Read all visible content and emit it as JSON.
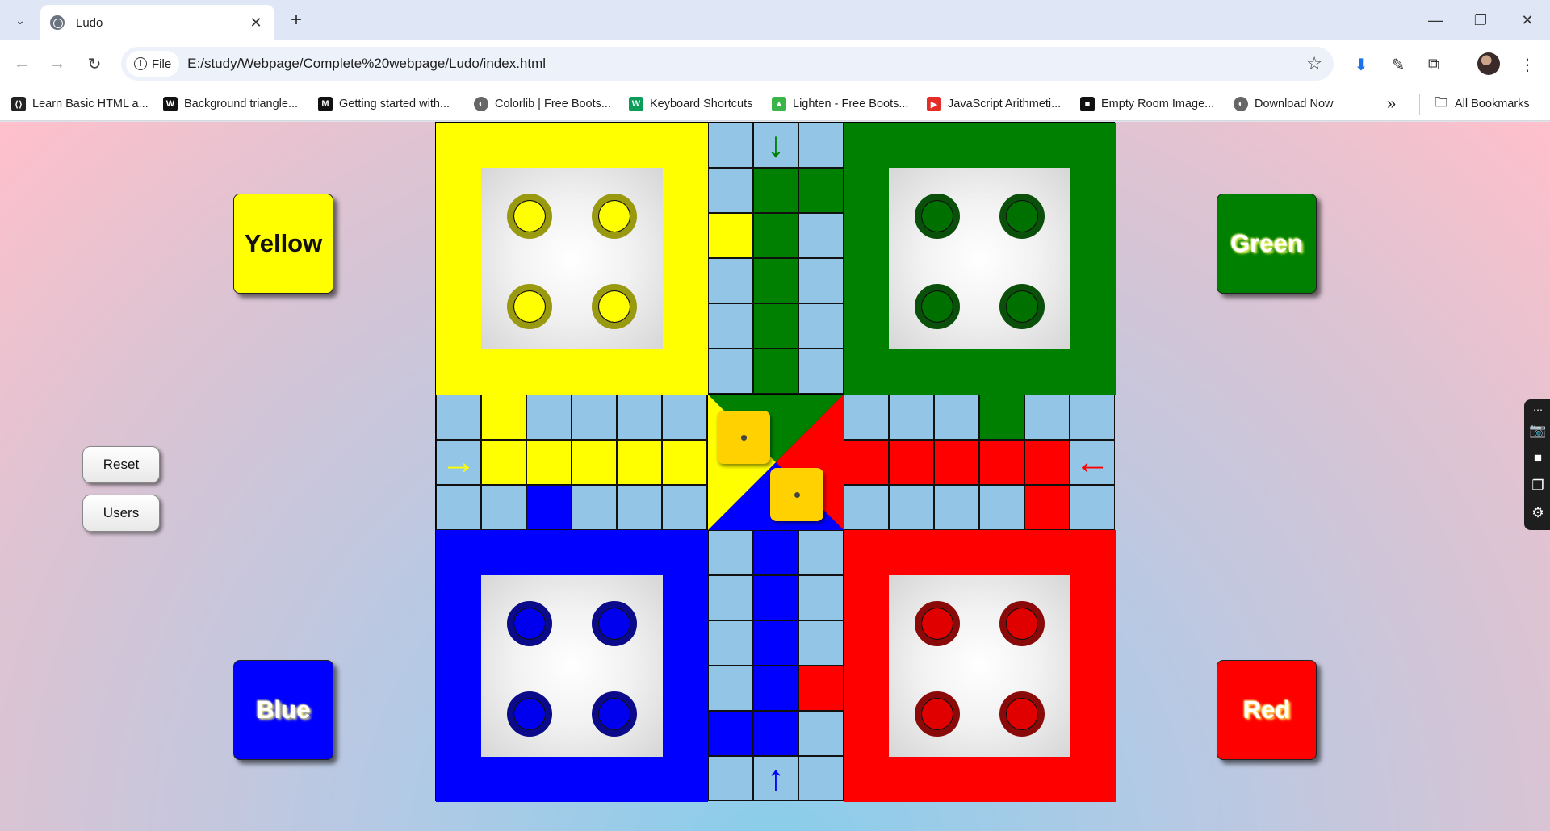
{
  "browser": {
    "tab_title": "Ludo",
    "new_tab_label": "+",
    "site_chip_label": "File",
    "url": "E:/study/Webpage/Complete%20webpage/Ludo/index.html",
    "bookmarks": [
      {
        "label": "Learn Basic HTML a...",
        "icon_color": "#222222",
        "icon_text": "⟨⟩"
      },
      {
        "label": "Background triangle...",
        "icon_color": "#111111",
        "icon_text": "W"
      },
      {
        "label": "Getting started with...",
        "icon_color": "#111111",
        "icon_text": "M"
      },
      {
        "label": "Colorlib | Free Boots...",
        "icon_color": "#666666",
        "icon_text": "◐"
      },
      {
        "label": "Keyboard Shortcuts",
        "icon_color": "#0a9d58",
        "icon_text": "W"
      },
      {
        "label": "Lighten - Free Boots...",
        "icon_color": "#3bb54a",
        "icon_text": "▲"
      },
      {
        "label": "JavaScript Arithmeti...",
        "icon_color": "#e52d27",
        "icon_text": "▶"
      },
      {
        "label": "Empty Room Image...",
        "icon_color": "#111111",
        "icon_text": "■"
      },
      {
        "label": "Download Now",
        "icon_color": "#666666",
        "icon_text": "◐"
      }
    ],
    "more_bookmarks": "»",
    "all_bookmarks_label": "All Bookmarks"
  },
  "game": {
    "player_buttons": {
      "yellow": "Yellow",
      "green": "Green",
      "blue": "Blue",
      "red": "Red"
    },
    "controls": {
      "reset": "Reset",
      "users": "Users"
    },
    "dice": [
      {
        "owner": "yellow",
        "value": 1
      },
      {
        "owner": "red",
        "value": 1
      }
    ],
    "colors": {
      "yellow": "#ffff00",
      "green": "#008000",
      "red": "#ff0000",
      "blue": "#0000ff",
      "track": "#93c5e6",
      "dice": "#ffd100"
    },
    "arrows": {
      "green": "↓",
      "yellow": "→",
      "red": "←",
      "blue": "↑"
    }
  }
}
